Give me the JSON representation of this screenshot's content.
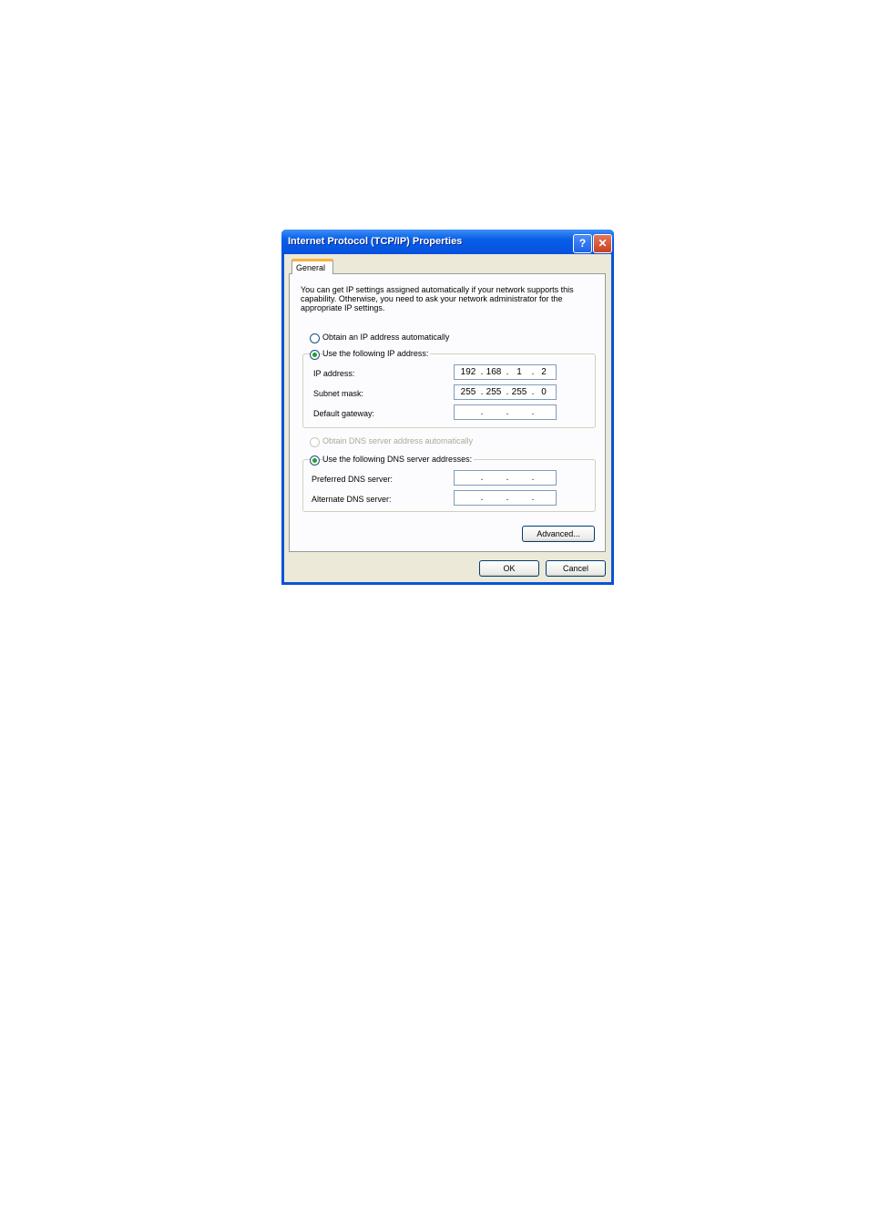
{
  "dialog": {
    "title": "Internet Protocol (TCP/IP) Properties",
    "help_label": "?",
    "close_label": "✕"
  },
  "tabs": [
    {
      "label": "General"
    }
  ],
  "general": {
    "description": "You can get IP settings assigned automatically if your network supports this capability. Otherwise, you need to ask your network administrator for the appropriate IP settings.",
    "radio_ip_auto": {
      "label": "Obtain an IP address automatically",
      "checked": false
    },
    "radio_ip_manual": {
      "label": "Use the following IP address:",
      "checked": true
    },
    "ip_address": {
      "label": "IP address:",
      "octets": [
        "192",
        "168",
        "1",
        "2"
      ]
    },
    "subnet_mask": {
      "label": "Subnet mask:",
      "octets": [
        "255",
        "255",
        "255",
        "0"
      ]
    },
    "default_gateway": {
      "label": "Default gateway:",
      "octets": [
        "",
        "",
        "",
        ""
      ]
    },
    "radio_dns_auto": {
      "label": "Obtain DNS server address automatically",
      "checked": false,
      "disabled": true
    },
    "radio_dns_manual": {
      "label": "Use the following DNS server addresses:",
      "checked": true
    },
    "preferred_dns": {
      "label": "Preferred DNS server:",
      "octets": [
        "",
        "",
        "",
        ""
      ]
    },
    "alternate_dns": {
      "label": "Alternate DNS server:",
      "octets": [
        "",
        "",
        "",
        ""
      ]
    },
    "advanced_label": "Advanced..."
  },
  "footer": {
    "ok_label": "OK",
    "cancel_label": "Cancel"
  },
  "ip_dot": "."
}
